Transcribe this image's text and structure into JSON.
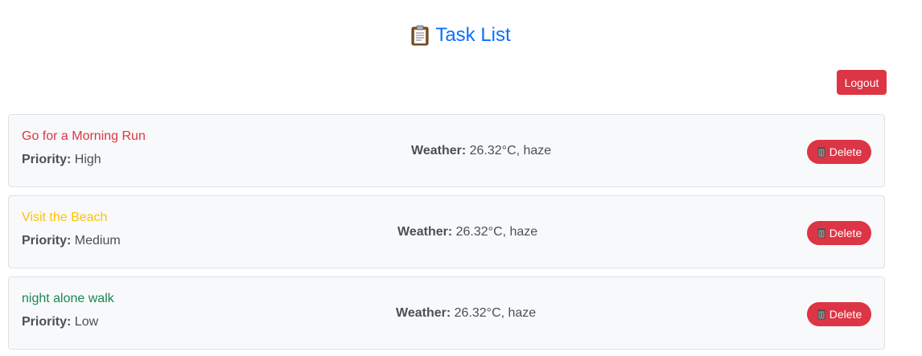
{
  "header": {
    "title": "Task List",
    "icon": "clipboard-icon"
  },
  "logout_label": "Logout",
  "weather_label": "Weather:",
  "priority_label": "Priority:",
  "delete_label": "Delete",
  "tasks": [
    {
      "title": "Go for a Morning Run",
      "title_color": "#dc3545",
      "priority": "High",
      "weather": "26.32°C, haze"
    },
    {
      "title": "Visit the Beach",
      "title_color": "#ffc107",
      "priority": "Medium",
      "weather": "26.32°C, haze"
    },
    {
      "title": "night alone walk",
      "title_color": "#198754",
      "priority": "Low",
      "weather": "26.32°C, haze"
    }
  ]
}
